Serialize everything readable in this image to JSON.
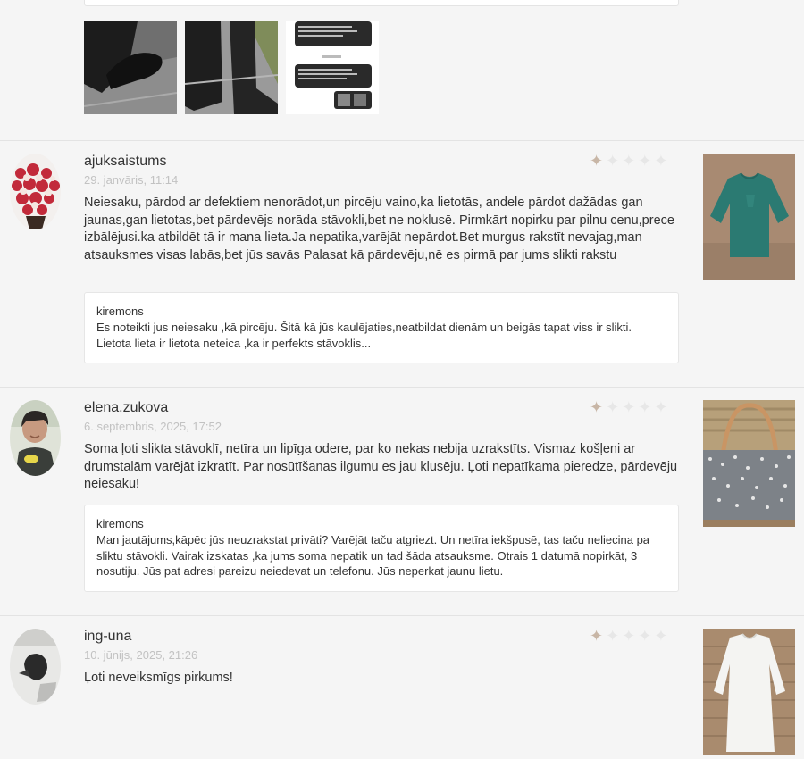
{
  "reviews": [
    {
      "username": "ajuksaistums",
      "date": "29. janvāris, 11:14",
      "rating": 1,
      "text": "Neiesaku, pārdod ar defektiem nenorādot,un pircēju vaino,ka lietotās, andele pārdot dažādas gan jaunas,gan lietotas,bet pārdevējs norāda stāvokli,bet ne noklusē. Pirmkārt nopirku par pilnu cenu,prece izbālējusi.ka atbildēt tā ir mana lieta.Ja nepatika,varējāt nepārdot.Bet murgus rakstīt nevajag,man atsauksmes visas labās,bet jūs savās Palasat kā pārdevēju,nē es pirmā par jums slikti rakstu",
      "reply": {
        "author": "kiremons",
        "text": "Es noteikti jus neiesaku ,kā pircēju. Šitā kā jūs kaulējaties,neatbildat dienām un beigās tapat viss ir slikti. Lietota lieta ir lietota neteica ,ka ir perfekts stāvoklis..."
      }
    },
    {
      "username": "elena.zukova",
      "date": "6. septembris, 2025, 17:52",
      "rating": 1,
      "text": "Soma ļoti slikta stāvoklī, netīra un lipīga odere, par ko nekas nebija uzrakstīts. Vismaz košļeni ar drumstalām varējāt izkratīt. Par nosūtīšanas ilgumu es jau klusēju. Ļoti nepatīkama pieredze, pārdevēju neiesaku!",
      "reply": {
        "author": "kiremons",
        "text": "Man jautājums,kāpēc jūs neuzrakstat privāti? Varējāt taču atgriezt. Un netīra iekšpusē, tas taču neliecina pa sliktu stāvokli. Vairak izskatas ,ka jums soma nepatik un tad šāda atsauksme. Otrais 1 datumā nopirkāt, 3 nosutiju. Jūs pat adresi pareizu neiedevat un telefonu. Jūs neperkat jaunu lietu."
      }
    },
    {
      "username": "ing-una",
      "date": "10. jūnijs, 2025, 21:26",
      "rating": 1,
      "text": "Ļoti neveiksmīgs pirkums!"
    }
  ],
  "top_photos": [
    "shoe-photo",
    "boot-photo",
    "chat-screenshot"
  ]
}
